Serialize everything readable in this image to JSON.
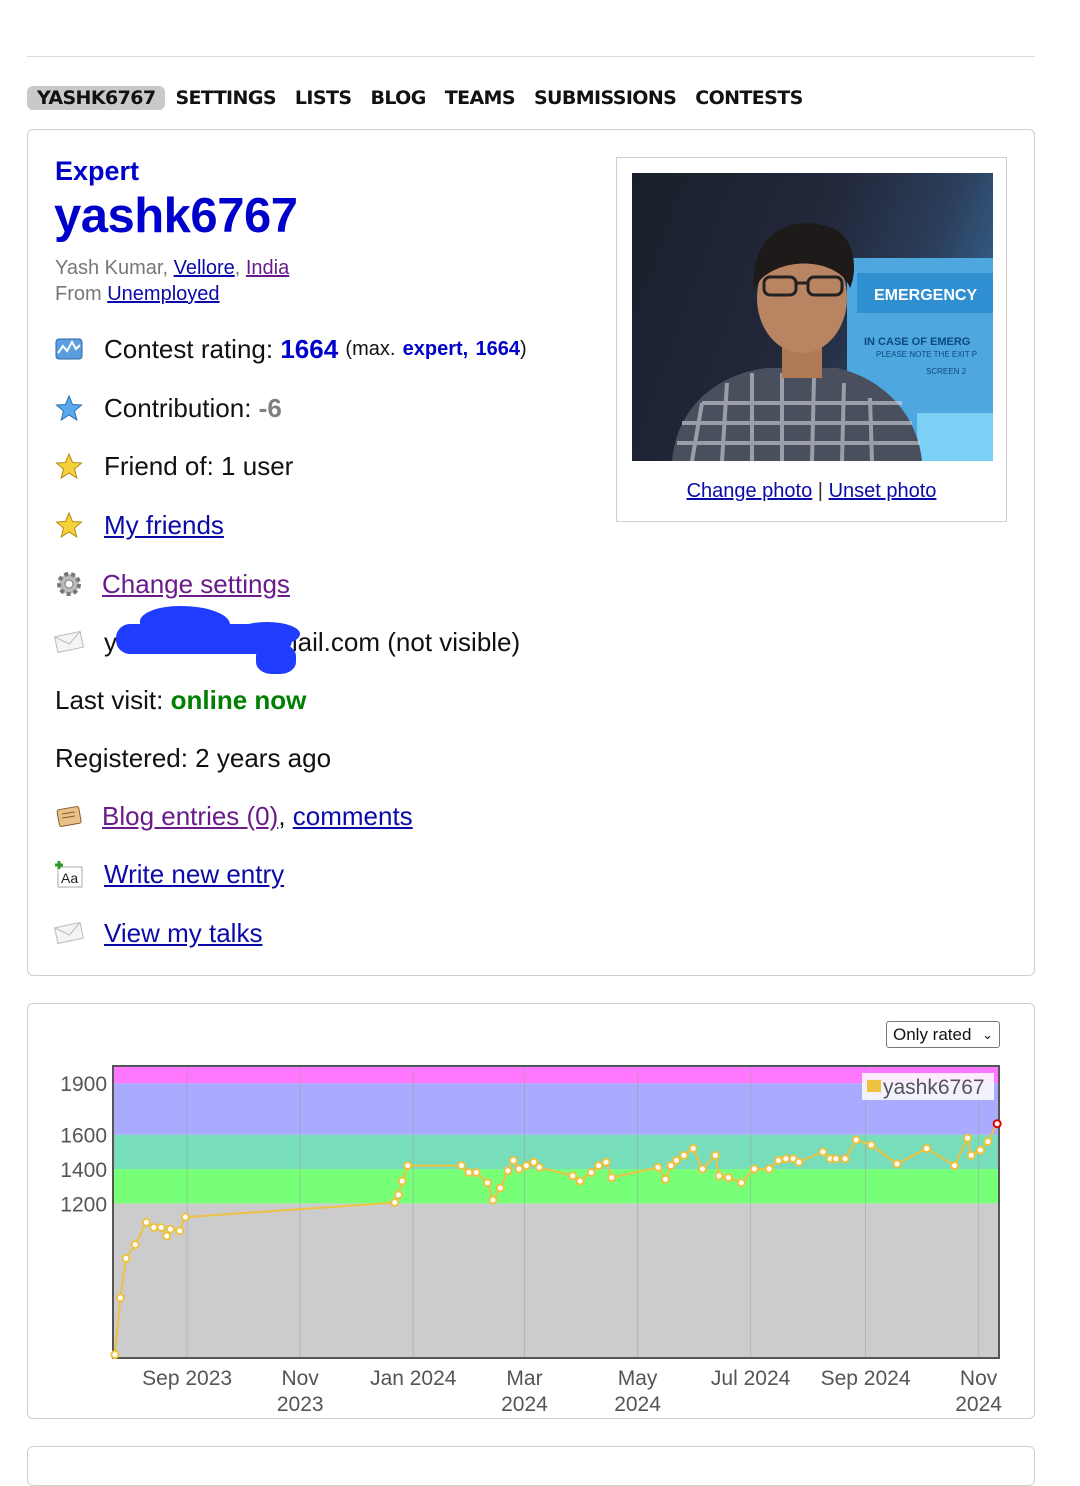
{
  "nav": {
    "tabs": [
      "YASHK6767",
      "SETTINGS",
      "LISTS",
      "BLOG",
      "TEAMS",
      "SUBMISSIONS",
      "CONTESTS"
    ]
  },
  "profile": {
    "rank": "Expert",
    "handle": "yashk6767",
    "full_name": "Yash Kumar",
    "city": "Vellore",
    "country": "India",
    "from_label": "From",
    "organization": "Unemployed",
    "contest_rating_label": "Contest rating:",
    "contest_rating": "1664",
    "max_open": "(max.",
    "max_rank": "expert,",
    "max_rating": "1664",
    "max_close": ")",
    "contribution_label": "Contribution:",
    "contribution": "-6",
    "friend_of": "Friend of: 1 user",
    "my_friends": "My friends",
    "change_settings": "Change settings",
    "email_start": "y",
    "email_end": "mail.com (not visible)",
    "last_visit_label": "Last visit:",
    "last_visit": "online now",
    "registered": "Registered: 2 years ago",
    "blog_entries": "Blog entries (0)",
    "comments": "comments",
    "write_entry": "Write new entry",
    "view_talks": "View my talks"
  },
  "photo": {
    "change": "Change photo",
    "separator": "|",
    "unset": "Unset photo",
    "sign_title": "EMERGENCY",
    "sign_line1": "IN CASE OF EMERG",
    "sign_line2": "PLEASE NOTE THE EXIT P",
    "sign_line3": "SCREEN 2"
  },
  "chart_controls": {
    "filter_selected": "Only rated"
  },
  "colors": {
    "rank_blue": "#0000cc",
    "online_green": "#008000",
    "band_pink": "#ff77ff",
    "band_blue": "#aaaaff",
    "band_teal": "#77ddbb",
    "band_green": "#77ff77",
    "band_grey": "#cccccc",
    "line": "#edc240"
  },
  "chart_data": {
    "type": "line",
    "series": [
      {
        "name": "yashk6767",
        "points": [
          [
            "2023-07-24",
            320
          ],
          [
            "2023-07-27",
            650
          ],
          [
            "2023-07-30",
            880
          ],
          [
            "2023-08-04",
            960
          ],
          [
            "2023-08-10",
            1090
          ],
          [
            "2023-08-14",
            1060
          ],
          [
            "2023-08-18",
            1060
          ],
          [
            "2023-08-21",
            1010
          ],
          [
            "2023-08-23",
            1050
          ],
          [
            "2023-08-28",
            1040
          ],
          [
            "2023-08-31",
            1120
          ],
          [
            "2023-12-22",
            1205
          ],
          [
            "2023-12-24",
            1250
          ],
          [
            "2023-12-26",
            1330
          ],
          [
            "2023-12-29",
            1420
          ],
          [
            "2024-01-27",
            1420
          ],
          [
            "2024-01-31",
            1380
          ],
          [
            "2024-02-04",
            1380
          ],
          [
            "2024-02-10",
            1320
          ],
          [
            "2024-02-13",
            1220
          ],
          [
            "2024-02-17",
            1290
          ],
          [
            "2024-02-21",
            1390
          ],
          [
            "2024-02-24",
            1450
          ],
          [
            "2024-02-27",
            1400
          ],
          [
            "2024-03-02",
            1420
          ],
          [
            "2024-03-06",
            1440
          ],
          [
            "2024-03-09",
            1410
          ],
          [
            "2024-03-27",
            1360
          ],
          [
            "2024-03-31",
            1330
          ],
          [
            "2024-04-06",
            1380
          ],
          [
            "2024-04-10",
            1420
          ],
          [
            "2024-04-14",
            1440
          ],
          [
            "2024-04-17",
            1350
          ],
          [
            "2024-05-12",
            1410
          ],
          [
            "2024-05-16",
            1340
          ],
          [
            "2024-05-19",
            1420
          ],
          [
            "2024-05-22",
            1450
          ],
          [
            "2024-05-26",
            1480
          ],
          [
            "2024-05-31",
            1520
          ],
          [
            "2024-06-05",
            1400
          ],
          [
            "2024-06-12",
            1480
          ],
          [
            "2024-06-14",
            1360
          ],
          [
            "2024-06-19",
            1350
          ],
          [
            "2024-06-26",
            1320
          ],
          [
            "2024-07-03",
            1400
          ],
          [
            "2024-07-11",
            1400
          ],
          [
            "2024-07-16",
            1450
          ],
          [
            "2024-07-20",
            1460
          ],
          [
            "2024-07-24",
            1460
          ],
          [
            "2024-07-27",
            1440
          ],
          [
            "2024-08-09",
            1500
          ],
          [
            "2024-08-13",
            1460
          ],
          [
            "2024-08-16",
            1460
          ],
          [
            "2024-08-21",
            1460
          ],
          [
            "2024-08-27",
            1570
          ],
          [
            "2024-09-04",
            1540
          ],
          [
            "2024-09-18",
            1430
          ],
          [
            "2024-10-04",
            1520
          ],
          [
            "2024-10-19",
            1420
          ],
          [
            "2024-10-26",
            1580
          ],
          [
            "2024-10-28",
            1480
          ],
          [
            "2024-11-02",
            1510
          ],
          [
            "2024-11-06",
            1560
          ],
          [
            "2024-11-11",
            1664
          ]
        ]
      }
    ],
    "x_range": [
      "2023-07-23",
      "2024-11-12"
    ],
    "x_ticks": [
      {
        "date": "2023-09-01",
        "label": [
          "Sep 2023"
        ]
      },
      {
        "date": "2023-11-01",
        "label": [
          "Nov",
          "2023"
        ]
      },
      {
        "date": "2024-01-01",
        "label": [
          "Jan 2024"
        ]
      },
      {
        "date": "2024-03-01",
        "label": [
          "Mar",
          "2024"
        ]
      },
      {
        "date": "2024-05-01",
        "label": [
          "May",
          "2024"
        ]
      },
      {
        "date": "2024-07-01",
        "label": [
          "Jul 2024"
        ]
      },
      {
        "date": "2024-09-01",
        "label": [
          "Sep 2024"
        ]
      },
      {
        "date": "2024-11-01",
        "label": [
          "Nov",
          "2024"
        ]
      }
    ],
    "y_ticks": [
      1200,
      1400,
      1600,
      1900
    ],
    "ylim": [
      300,
      2000
    ],
    "bands": [
      {
        "from": 300,
        "to": 1200,
        "color": "#cccccc"
      },
      {
        "from": 1200,
        "to": 1400,
        "color": "#77ff77"
      },
      {
        "from": 1400,
        "to": 1600,
        "color": "#77ddbb"
      },
      {
        "from": 1600,
        "to": 1900,
        "color": "#aaaaff"
      },
      {
        "from": 1900,
        "to": 2000,
        "color": "#ff77ff"
      }
    ],
    "legend": "top-right",
    "grid": true
  }
}
